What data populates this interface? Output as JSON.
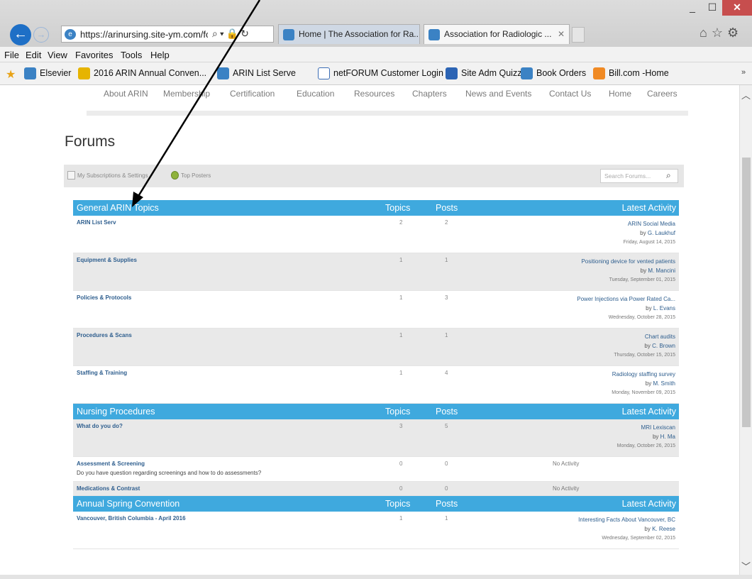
{
  "browser": {
    "url": "https://arinursing.site-ym.com/fo",
    "tabs": [
      {
        "label": "Home | The Association for Ra..."
      },
      {
        "label": "Association for Radiologic ..."
      }
    ],
    "window_controls": {
      "minimize": "_",
      "maximize": "☐",
      "close": "✕"
    },
    "menu": [
      "File",
      "Edit",
      "View",
      "Favorites",
      "Tools",
      "Help"
    ],
    "favorites": [
      "Elsevier",
      "2016 ARIN Annual Conven...",
      "ARIN List Serve",
      "netFORUM Customer Login",
      "Site Adm Quizzes",
      "Book Orders",
      "Bill.com -Home"
    ],
    "favorites_more": "»"
  },
  "site_nav": [
    "About ARIN",
    "Membership",
    "Certification",
    "Education",
    "Resources",
    "Chapters",
    "News and Events",
    "Contact Us",
    "Home",
    "Careers"
  ],
  "page": {
    "title": "Forums",
    "subscriptions_link": "My Subscriptions & Settings",
    "top_posters_link": "Top Posters",
    "search_placeholder": "Search Forums..."
  },
  "columns": {
    "topics": "Topics",
    "posts": "Posts",
    "latest": "Latest Activity"
  },
  "categories": [
    {
      "title": "General ARIN Topics",
      "forums": [
        {
          "name": "ARIN List Serv",
          "topics": "2",
          "posts": "2",
          "latest_title": "ARIN Social Media",
          "latest_by": "by",
          "latest_author": "G. Laukhuf",
          "latest_date": "Friday, August 14, 2015"
        },
        {
          "name": "Equipment & Supplies",
          "topics": "1",
          "posts": "1",
          "latest_title": "Positioning device for vented patients",
          "latest_by": "by",
          "latest_author": "M. Mancini",
          "latest_date": "Tuesday, September 01, 2015"
        },
        {
          "name": "Policies & Protocols",
          "topics": "1",
          "posts": "3",
          "latest_title": "Power Injections via Power Rated Ca...",
          "latest_by": "by",
          "latest_author": "L. Evans",
          "latest_date": "Wednesday, October 28, 2015"
        },
        {
          "name": "Procedures & Scans",
          "topics": "1",
          "posts": "1",
          "latest_title": "Chart audits",
          "latest_by": "by",
          "latest_author": "C. Brown",
          "latest_date": "Thursday, October 15, 2015"
        },
        {
          "name": "Staffing & Training",
          "topics": "1",
          "posts": "4",
          "latest_title": "Radiology staffing survey",
          "latest_by": "by",
          "latest_author": "M. Smith",
          "latest_date": "Monday, November 09, 2015"
        }
      ]
    },
    {
      "title": "Nursing Procedures",
      "forums": [
        {
          "name": "What do you do?",
          "topics": "3",
          "posts": "5",
          "latest_title": "MRI Lexiscan",
          "latest_by": "by",
          "latest_author": "H. Ma",
          "latest_date": "Monday, October 26, 2015"
        },
        {
          "name": "Assessment & Screening",
          "description": "Do you have question regarding screenings and how to do assessments?",
          "topics": "0",
          "posts": "0",
          "no_activity": "No Activity"
        },
        {
          "name": "Medications & Contrast",
          "topics": "0",
          "posts": "0",
          "no_activity": "No Activity"
        }
      ]
    },
    {
      "title": "Annual Spring Convention",
      "forums": [
        {
          "name": "Vancouver, British Columbia - April 2016",
          "topics": "1",
          "posts": "1",
          "latest_title": "Interesting Facts About Vancouver, BC",
          "latest_by": "by",
          "latest_author": "K. Reese",
          "latest_date": "Wednesday, September 02, 2015"
        }
      ]
    }
  ],
  "colors": {
    "header_blue": "#3fa9de",
    "link_blue": "#2e5e8e",
    "row_alt": "#e9e9e9",
    "annotation": "#000000"
  }
}
